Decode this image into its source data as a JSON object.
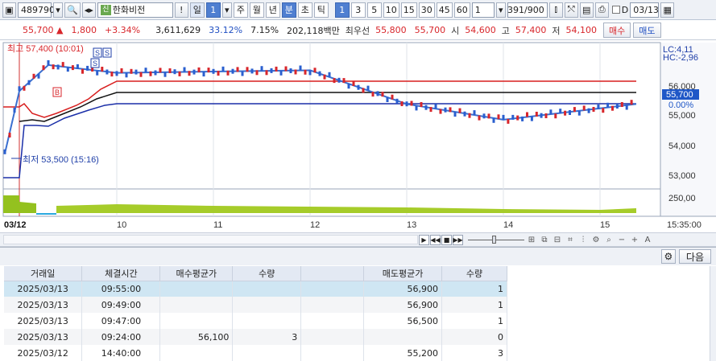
{
  "toolbar": {
    "code": "489790",
    "stock_name": "한화비전",
    "shin_badge": "신",
    "warn": "!",
    "period_unit": "일",
    "period_count": "1",
    "periods": [
      "주",
      "월",
      "년",
      "분",
      "초",
      "틱"
    ],
    "minutes": [
      "1",
      "3",
      "5",
      "10",
      "15",
      "30",
      "45",
      "60"
    ],
    "count_value": "1",
    "page_counter": "391/900",
    "date_prefix": "D",
    "date": "03/13"
  },
  "quote": {
    "price": "55,700",
    "change": "1,800",
    "change_pct": "+3.34%",
    "volume": "3,611,629",
    "vol_ratio": "33.12%",
    "turnover": "7.15%",
    "amount": "202,118백만",
    "best_label": "최우선",
    "best_ask": "55,800",
    "best_bid": "55,700",
    "open_label": "시",
    "open": "54,600",
    "high_label": "고",
    "high": "57,400",
    "low_label": "저",
    "low": "54,100",
    "buy_label": "매수",
    "sell_label": "매도"
  },
  "chart": {
    "lc": "LC:4,11",
    "hc": "HC:-2,96",
    "high_label": "최고 57,400 (10:01)",
    "low_label": "최저 53,500 (15:16)",
    "cur_price": "55,700",
    "cur_pct": "0.00%",
    "y_ticks": [
      "56,000",
      "55,000",
      "54,000",
      "53,000"
    ],
    "vol_tick": "250,00",
    "start_date": "03/12",
    "x_labels": [
      "10",
      "11",
      "12",
      "13",
      "14",
      "15"
    ],
    "time_label": "15:35:00",
    "markers": [
      "S",
      "S",
      "S",
      "B"
    ]
  },
  "chart_data": {
    "type": "line",
    "title": "",
    "ylim": [
      52500,
      58000
    ],
    "x": [
      "03/12",
      "10",
      "11",
      "12",
      "13",
      "14",
      "15"
    ],
    "series": [
      {
        "values": [
          53800,
          56200,
          57200,
          56900,
          57000,
          55700,
          55100,
          55700
        ]
      }
    ],
    "high": 57400,
    "low": 53500,
    "last": 55700
  },
  "grid": {
    "next_label": "다음",
    "columns": [
      "거래일",
      "체결시간",
      "매수평균가",
      "수량",
      "",
      "매도평균가",
      "수량"
    ],
    "rows": [
      [
        "2025/03/13",
        "09:55:00",
        "",
        "",
        "",
        "56,900",
        "1"
      ],
      [
        "2025/03/13",
        "09:49:00",
        "",
        "",
        "",
        "56,900",
        "1"
      ],
      [
        "2025/03/13",
        "09:47:00",
        "",
        "",
        "",
        "56,500",
        "1"
      ],
      [
        "2025/03/13",
        "09:24:00",
        "56,100",
        "3",
        "",
        "",
        "0"
      ],
      [
        "2025/03/12",
        "14:40:00",
        "",
        "",
        "",
        "55,200",
        "3"
      ]
    ]
  }
}
